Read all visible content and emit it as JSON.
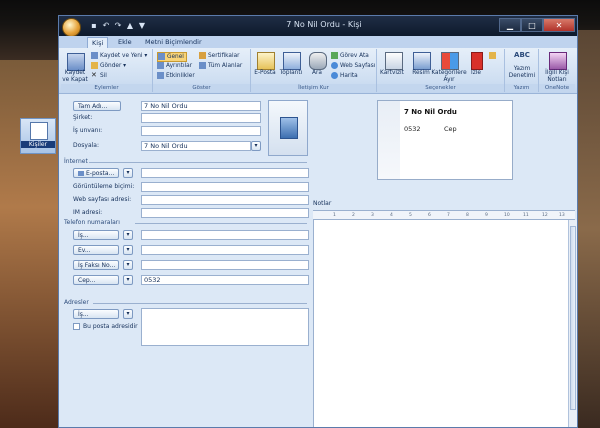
{
  "window": {
    "title": "7 No Nil Ordu - Kişi"
  },
  "desktop": {
    "icon_label": "Kişiler"
  },
  "title_buttons": {
    "minimize": "▁",
    "maximize": "□",
    "close": "✕"
  },
  "tabs": [
    "Kişi",
    "Ekle",
    "Metni Biçimlendir"
  ],
  "ribbon": {
    "eylemler": {
      "name": "Eylemler",
      "save_close": "Kaydet ve Kapat",
      "save_new": "Kaydet ve Yeni ▾",
      "send": "Gönder ▾",
      "delete": "Sil"
    },
    "goster": {
      "name": "Göster",
      "general": "Genel",
      "details": "Ayrıntılar",
      "activities": "Etkinlikler",
      "certs": "Sertifikalar",
      "all_fields": "Tüm Alanlar"
    },
    "iletisim": {
      "name": "İletişim Kur",
      "email": "E-Posta",
      "meeting": "Toplantı",
      "call": "Ara",
      "assign_task": "Görev Ata",
      "web_page": "Web Sayfası",
      "map": "Harita"
    },
    "secenekler": {
      "name": "Seçenekler",
      "card": "Kartvizit",
      "picture": "Resim",
      "categorize": "Kategorilere Ayır",
      "followup": "İzle"
    },
    "yazim": {
      "name": "Yazım",
      "spelling": "Yazım Denetimi"
    },
    "onenote": {
      "name": "OneNote",
      "notes": "İlgili Kişi Notları"
    }
  },
  "form": {
    "full_name_button": "Tam Adı...",
    "full_name_value": "7 No Nil Ordu",
    "company_label": "Şirket:",
    "job_label": "İş unvanı:",
    "file_as_label": "Dosyala:",
    "file_as_value": "7 No Nil Ordu",
    "internet_section": "İnternet",
    "email_button": "E-posta...",
    "display_as_label": "Görüntüleme biçimi:",
    "web_label": "Web sayfası adresi:",
    "im_label": "IM adresi:",
    "phones_section": "Telefon numaraları",
    "phone_work": "İş...",
    "phone_home": "Ev...",
    "phone_fax": "İş Faksı No...",
    "phone_mobile": "Cep...",
    "mobile_value": "0532",
    "address_section": "Adresler",
    "address_work": "İş...",
    "mailing_checkbox": "Bu posta adresidir",
    "notes_label": "Notlar"
  },
  "card": {
    "name": "7 No Nil Ordu",
    "phone": "0532",
    "phone_type": "Cep"
  },
  "ruler_ticks": [
    "1",
    "2",
    "3",
    "4",
    "5",
    "6",
    "7",
    "8",
    "9",
    "10",
    "11",
    "12",
    "13"
  ]
}
